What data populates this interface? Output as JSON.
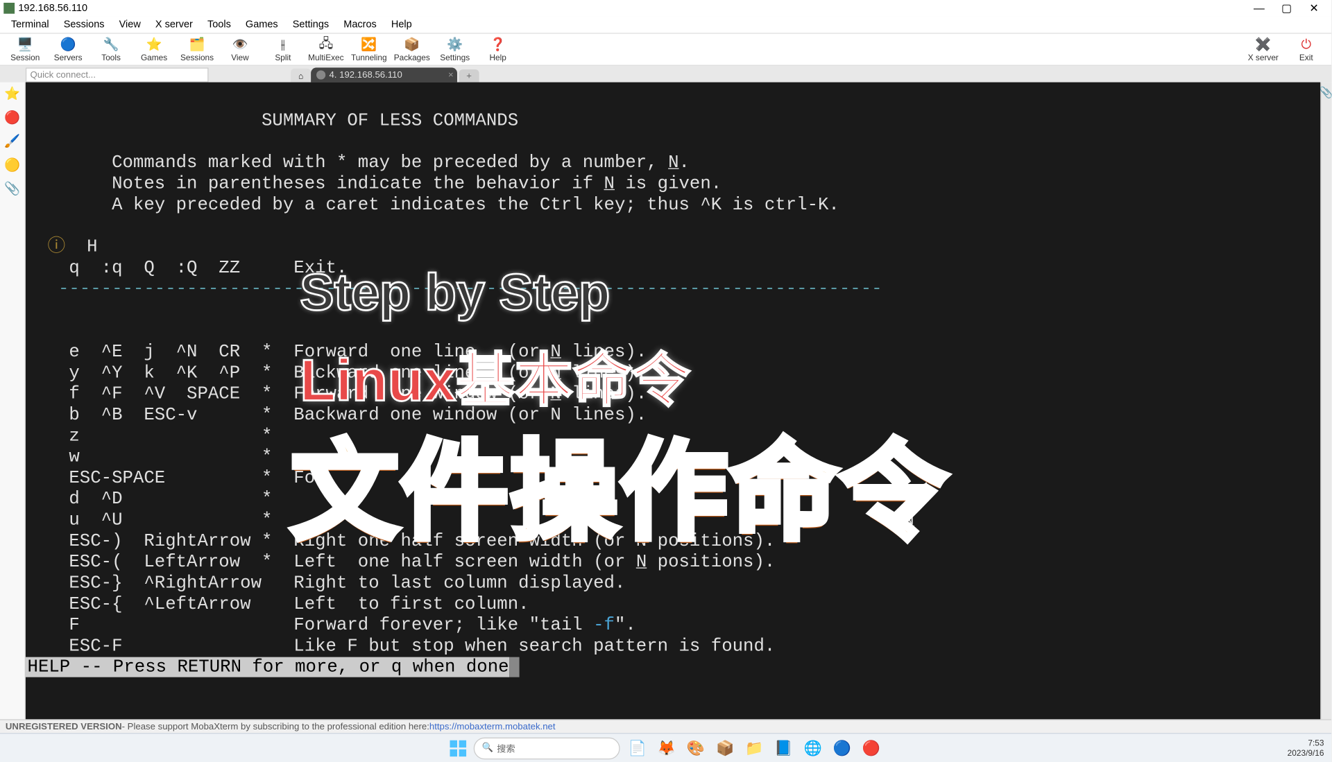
{
  "window": {
    "title": "192.168.56.110"
  },
  "menubar": [
    "Terminal",
    "Sessions",
    "View",
    "X server",
    "Tools",
    "Games",
    "Settings",
    "Macros",
    "Help"
  ],
  "toolbar_left": [
    {
      "icon": "🖥️",
      "label": "Session"
    },
    {
      "icon": "🔵",
      "label": "Servers"
    },
    {
      "icon": "🔧",
      "label": "Tools"
    },
    {
      "icon": "⭐",
      "label": "Games"
    },
    {
      "icon": "🗂️",
      "label": "Sessions"
    },
    {
      "icon": "👁️",
      "label": "View"
    },
    {
      "icon": "⫲",
      "label": "Split"
    },
    {
      "icon": "🖧",
      "label": "MultiExec"
    },
    {
      "icon": "🔀",
      "label": "Tunneling"
    },
    {
      "icon": "📦",
      "label": "Packages"
    },
    {
      "icon": "⚙️",
      "label": "Settings"
    },
    {
      "icon": "❓",
      "label": "Help"
    }
  ],
  "toolbar_right": [
    {
      "icon": "✖️",
      "label": "X server",
      "color": "#3aa34a"
    },
    {
      "icon": "⏻",
      "label": "Exit",
      "color": "#d33"
    }
  ],
  "quick_connect_placeholder": "Quick connect...",
  "tab": {
    "index": "4.",
    "title": "192.168.56.110"
  },
  "sidebar_icons": [
    "⭐",
    "🔴",
    "🖌️",
    "🟡",
    "📎"
  ],
  "terminal": {
    "title_line": "                    SUMMARY OF LESS COMMANDS",
    "intro1": "      Commands marked with * may be preceded by a number, ",
    "intro1b": ".",
    "intro2": "      Notes in parentheses indicate the behavior if ",
    "intro2b": " is given.",
    "intro3": "      A key preceded by a caret indicates the Ctrl key; thus ^K is ctrl-K.",
    "h_line": "  H",
    "q_line": "  q  :q  Q  :Q  ZZ     Exit.",
    "dashes": " -----------------------------------------------------------------------------",
    "l_e": "  e  ^E  j  ^N  CR  *  Forward  one line   (or ",
    "l_e2": " lines).",
    "l_y": "  y  ^Y  k  ^K  ^P  *  Backward one line   (or ",
    "l_y2": " lines).",
    "l_f": "  f  ^F  ^V  SPACE  *  Forward  one window (or ",
    "l_f2": " lines).",
    "l_b": "  b  ^B  ESC-v      *  Backward one window (or N lines).",
    "l_z": "  z                 *  ",
    "l_w": "  w                 *  ",
    "l_esp": "  ESC-SPACE         *  For",
    "l_d": "  d  ^D             *  ",
    "l_u": "  u  ^U             *  ",
    "l_er": "  ESC-)  RightArrow *  Right one half screen width (or N positions).",
    "l_el": "  ESC-(  LeftArrow  *  Left  one half screen width (or ",
    "l_el2": " positions).",
    "l_ebr": "  ESC-}  ^RightArrow   Right to last column displayed.",
    "l_ebl": "  ESC-{  ^LeftArrow    Left  to first column.",
    "l_F": "  F                    Forward forever; like \"tail ",
    "l_F2": "\".",
    "l_ef": "  ESC-F                Like F but stop when search pattern is found.",
    "N": "N",
    "tailf": "-f",
    "help": "HELP -- Press RETURN for more, or q when done"
  },
  "overlays": {
    "step": "Step by Step",
    "linux": "Linux基本命令",
    "fileops": "文件操作命令"
  },
  "status": {
    "unreg": "UNREGISTERED VERSION",
    "msg": " -  Please support MobaXterm by subscribing to the professional edition here:  ",
    "link": "https://mobaxterm.mobatek.net"
  },
  "taskbar": {
    "search": "搜索",
    "time": "7:53",
    "date": "2023/9/16"
  }
}
